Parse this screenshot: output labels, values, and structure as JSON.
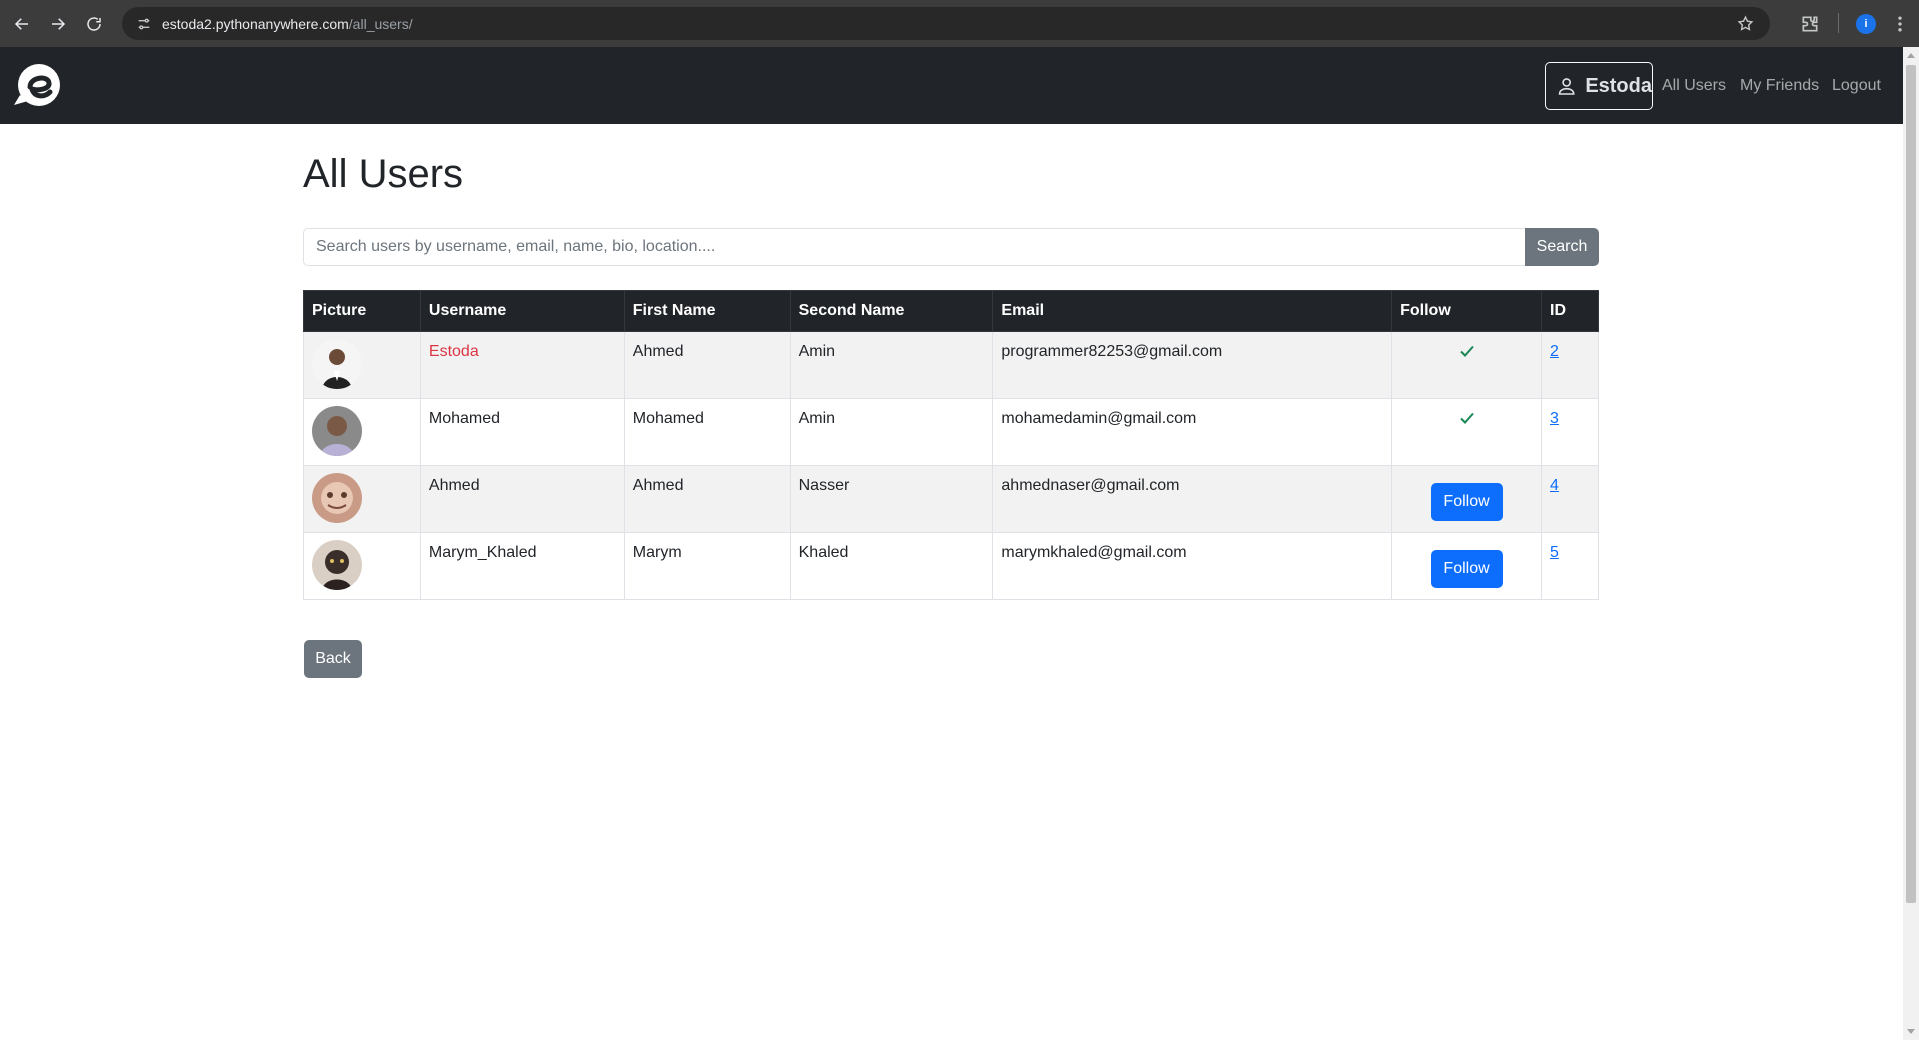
{
  "browser": {
    "url_host": "estoda2.pythonanywhere.com",
    "url_path": "/all_users/",
    "profile_initial": "i"
  },
  "navbar": {
    "user_button_label": "Estoda",
    "links": [
      "All Users",
      "My Friends",
      "Logout"
    ]
  },
  "page": {
    "title": "All Users",
    "search_placeholder": "Search users by username, email, name, bio, location....",
    "search_value": "",
    "search_button": "Search",
    "back_button": "Back"
  },
  "table": {
    "headers": [
      "Picture",
      "Username",
      "First Name",
      "Second Name",
      "Email",
      "Follow",
      "ID"
    ],
    "rows": [
      {
        "username": "Estoda",
        "first_name": "Ahmed",
        "second_name": "Amin",
        "email": "programmer82253@gmail.com",
        "follow_state": "following",
        "id": "2",
        "is_self": true
      },
      {
        "username": "Mohamed",
        "first_name": "Mohamed",
        "second_name": "Amin",
        "email": "mohamedamin@gmail.com",
        "follow_state": "following",
        "id": "3",
        "is_self": false
      },
      {
        "username": "Ahmed",
        "first_name": "Ahmed",
        "second_name": "Nasser",
        "email": "ahmednaser@gmail.com",
        "follow_state": "follow",
        "follow_label": "Follow",
        "id": "4",
        "is_self": false
      },
      {
        "username": "Marym_Khaled",
        "first_name": "Marym",
        "second_name": "Khaled",
        "email": "marymkhaled@gmail.com",
        "follow_state": "follow",
        "follow_label": "Follow",
        "id": "5",
        "is_self": false
      }
    ]
  },
  "colors": {
    "navbar_bg": "#212529",
    "primary": "#0d6efd",
    "secondary": "#6c757d",
    "danger": "#dc3545",
    "success": "#198754"
  }
}
